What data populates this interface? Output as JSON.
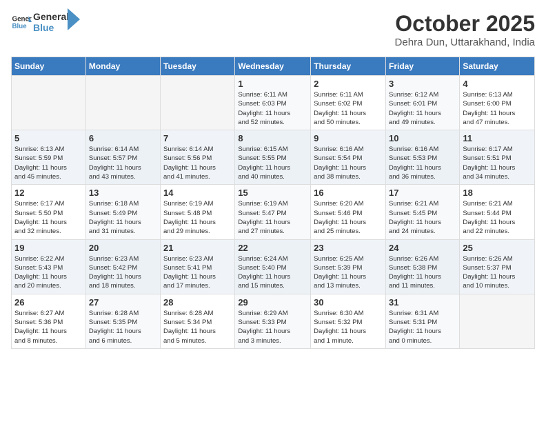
{
  "header": {
    "logo_line1": "General",
    "logo_line2": "Blue",
    "month": "October 2025",
    "location": "Dehra Dun, Uttarakhand, India"
  },
  "weekdays": [
    "Sunday",
    "Monday",
    "Tuesday",
    "Wednesday",
    "Thursday",
    "Friday",
    "Saturday"
  ],
  "weeks": [
    [
      {
        "day": "",
        "info": ""
      },
      {
        "day": "",
        "info": ""
      },
      {
        "day": "",
        "info": ""
      },
      {
        "day": "1",
        "info": "Sunrise: 6:11 AM\nSunset: 6:03 PM\nDaylight: 11 hours\nand 52 minutes."
      },
      {
        "day": "2",
        "info": "Sunrise: 6:11 AM\nSunset: 6:02 PM\nDaylight: 11 hours\nand 50 minutes."
      },
      {
        "day": "3",
        "info": "Sunrise: 6:12 AM\nSunset: 6:01 PM\nDaylight: 11 hours\nand 49 minutes."
      },
      {
        "day": "4",
        "info": "Sunrise: 6:13 AM\nSunset: 6:00 PM\nDaylight: 11 hours\nand 47 minutes."
      }
    ],
    [
      {
        "day": "5",
        "info": "Sunrise: 6:13 AM\nSunset: 5:59 PM\nDaylight: 11 hours\nand 45 minutes."
      },
      {
        "day": "6",
        "info": "Sunrise: 6:14 AM\nSunset: 5:57 PM\nDaylight: 11 hours\nand 43 minutes."
      },
      {
        "day": "7",
        "info": "Sunrise: 6:14 AM\nSunset: 5:56 PM\nDaylight: 11 hours\nand 41 minutes."
      },
      {
        "day": "8",
        "info": "Sunrise: 6:15 AM\nSunset: 5:55 PM\nDaylight: 11 hours\nand 40 minutes."
      },
      {
        "day": "9",
        "info": "Sunrise: 6:16 AM\nSunset: 5:54 PM\nDaylight: 11 hours\nand 38 minutes."
      },
      {
        "day": "10",
        "info": "Sunrise: 6:16 AM\nSunset: 5:53 PM\nDaylight: 11 hours\nand 36 minutes."
      },
      {
        "day": "11",
        "info": "Sunrise: 6:17 AM\nSunset: 5:51 PM\nDaylight: 11 hours\nand 34 minutes."
      }
    ],
    [
      {
        "day": "12",
        "info": "Sunrise: 6:17 AM\nSunset: 5:50 PM\nDaylight: 11 hours\nand 32 minutes."
      },
      {
        "day": "13",
        "info": "Sunrise: 6:18 AM\nSunset: 5:49 PM\nDaylight: 11 hours\nand 31 minutes."
      },
      {
        "day": "14",
        "info": "Sunrise: 6:19 AM\nSunset: 5:48 PM\nDaylight: 11 hours\nand 29 minutes."
      },
      {
        "day": "15",
        "info": "Sunrise: 6:19 AM\nSunset: 5:47 PM\nDaylight: 11 hours\nand 27 minutes."
      },
      {
        "day": "16",
        "info": "Sunrise: 6:20 AM\nSunset: 5:46 PM\nDaylight: 11 hours\nand 25 minutes."
      },
      {
        "day": "17",
        "info": "Sunrise: 6:21 AM\nSunset: 5:45 PM\nDaylight: 11 hours\nand 24 minutes."
      },
      {
        "day": "18",
        "info": "Sunrise: 6:21 AM\nSunset: 5:44 PM\nDaylight: 11 hours\nand 22 minutes."
      }
    ],
    [
      {
        "day": "19",
        "info": "Sunrise: 6:22 AM\nSunset: 5:43 PM\nDaylight: 11 hours\nand 20 minutes."
      },
      {
        "day": "20",
        "info": "Sunrise: 6:23 AM\nSunset: 5:42 PM\nDaylight: 11 hours\nand 18 minutes."
      },
      {
        "day": "21",
        "info": "Sunrise: 6:23 AM\nSunset: 5:41 PM\nDaylight: 11 hours\nand 17 minutes."
      },
      {
        "day": "22",
        "info": "Sunrise: 6:24 AM\nSunset: 5:40 PM\nDaylight: 11 hours\nand 15 minutes."
      },
      {
        "day": "23",
        "info": "Sunrise: 6:25 AM\nSunset: 5:39 PM\nDaylight: 11 hours\nand 13 minutes."
      },
      {
        "day": "24",
        "info": "Sunrise: 6:26 AM\nSunset: 5:38 PM\nDaylight: 11 hours\nand 11 minutes."
      },
      {
        "day": "25",
        "info": "Sunrise: 6:26 AM\nSunset: 5:37 PM\nDaylight: 11 hours\nand 10 minutes."
      }
    ],
    [
      {
        "day": "26",
        "info": "Sunrise: 6:27 AM\nSunset: 5:36 PM\nDaylight: 11 hours\nand 8 minutes."
      },
      {
        "day": "27",
        "info": "Sunrise: 6:28 AM\nSunset: 5:35 PM\nDaylight: 11 hours\nand 6 minutes."
      },
      {
        "day": "28",
        "info": "Sunrise: 6:28 AM\nSunset: 5:34 PM\nDaylight: 11 hours\nand 5 minutes."
      },
      {
        "day": "29",
        "info": "Sunrise: 6:29 AM\nSunset: 5:33 PM\nDaylight: 11 hours\nand 3 minutes."
      },
      {
        "day": "30",
        "info": "Sunrise: 6:30 AM\nSunset: 5:32 PM\nDaylight: 11 hours\nand 1 minute."
      },
      {
        "day": "31",
        "info": "Sunrise: 6:31 AM\nSunset: 5:31 PM\nDaylight: 11 hours\nand 0 minutes."
      },
      {
        "day": "",
        "info": ""
      }
    ]
  ]
}
